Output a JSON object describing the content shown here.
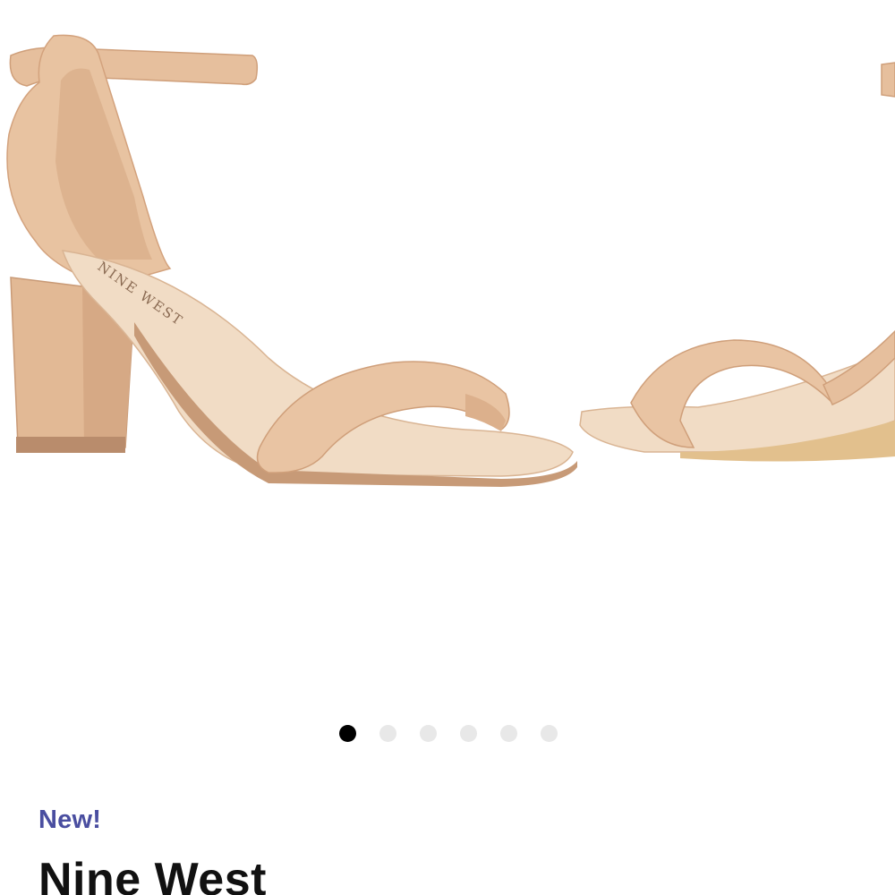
{
  "carousel": {
    "image_label": "Nude strappy block-heel sandal",
    "logo_text": "NINE WEST",
    "slide_count": 6,
    "active_index": 0,
    "colors": {
      "leather": "#e9c4a3",
      "leather_shadow": "#d6a985",
      "insole": "#f1dcc5",
      "buckle": "#c8c8c8",
      "dot_active": "#000000",
      "dot_inactive": "#e8e8e8"
    }
  },
  "product": {
    "badge": "New!",
    "brand": "Nine West",
    "badge_color": "#4a4ea0"
  }
}
